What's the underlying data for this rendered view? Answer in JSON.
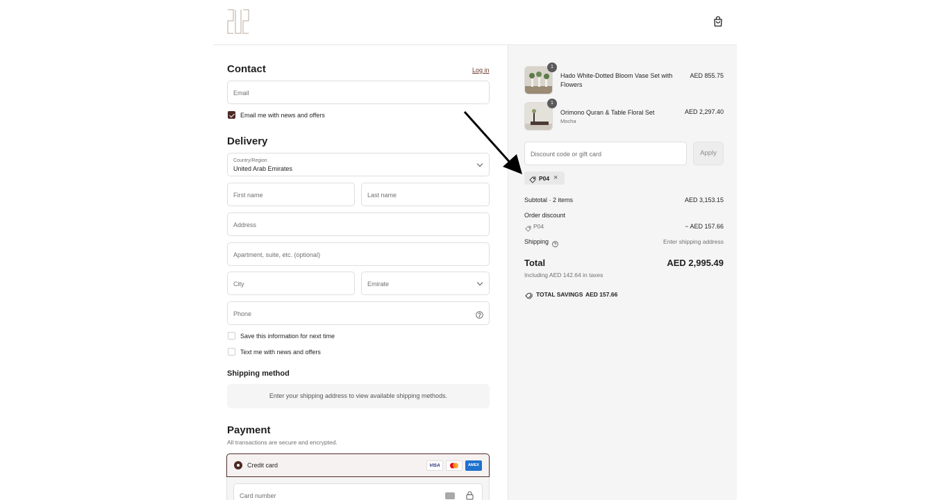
{
  "header": {
    "logo_alt": "store logo",
    "cart_icon": "shopping-bag-icon"
  },
  "contact": {
    "title": "Contact",
    "login_link": "Log in",
    "email_placeholder": "Email",
    "newsletter_label": "Email me with news and offers",
    "newsletter_checked": true
  },
  "delivery": {
    "title": "Delivery",
    "country_label": "Country/Region",
    "country_value": "United Arab Emirates",
    "first_name_placeholder": "First name",
    "last_name_placeholder": "Last name",
    "address_placeholder": "Address",
    "apartment_placeholder": "Apartment, suite, etc. (optional)",
    "city_placeholder": "City",
    "emirate_placeholder": "Emirate",
    "phone_placeholder": "Phone",
    "save_info_label": "Save this information for next time",
    "text_offers_label": "Text me with news and offers"
  },
  "shipping_method": {
    "title": "Shipping method",
    "notice": "Enter your shipping address to view available shipping methods."
  },
  "payment": {
    "title": "Payment",
    "subtitle": "All transactions are secure and encrypted.",
    "credit_card_label": "Credit card",
    "card_number_placeholder": "Card number",
    "card_brands": [
      "VISA",
      "mastercard",
      "AMEX"
    ]
  },
  "summary": {
    "items": [
      {
        "qty": "1",
        "name": "Hado White-Dotted Bloom Vase Set with Flowers",
        "variant": "",
        "price": "AED 855.75"
      },
      {
        "qty": "1",
        "name": "Orimono Quran & Table Floral Set",
        "variant": "Mocha",
        "price": "AED 2,297.40"
      }
    ],
    "discount_placeholder": "Discount code or gift card",
    "apply_label": "Apply",
    "applied_code": "P04",
    "subtotal_label": "Subtotal · 2 items",
    "subtotal_value": "AED 3,153.15",
    "order_discount_label": "Order discount",
    "discount_code": "P04",
    "discount_value": "− AED 157.66",
    "shipping_label": "Shipping",
    "shipping_value": "Enter shipping address",
    "total_label": "Total",
    "total_value": "AED 2,995.49",
    "taxes_note": "Including AED 142.64 in taxes",
    "savings_label": "TOTAL SAVINGS",
    "savings_value": "AED 157.66"
  },
  "colors": {
    "accent": "#4d2a25",
    "panel_bg": "#f5f5f5",
    "border": "#dedede"
  }
}
